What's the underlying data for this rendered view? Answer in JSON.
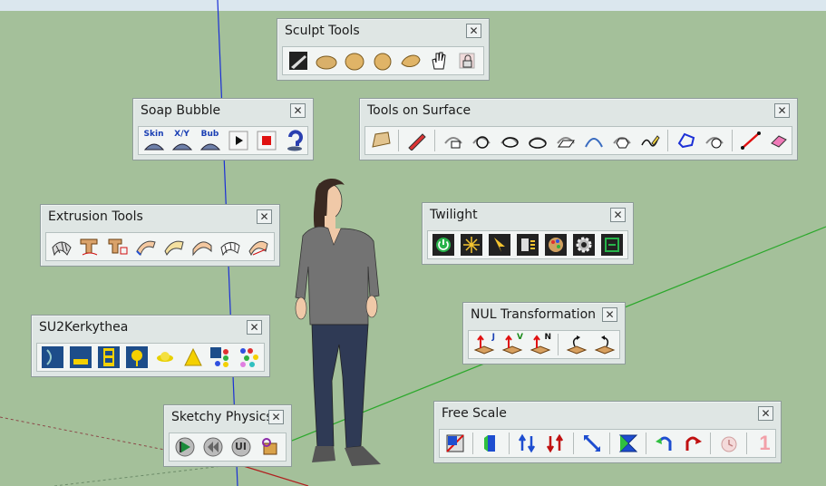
{
  "toolbars": {
    "sculpt_tools": {
      "title": "Sculpt Tools",
      "close": "✕"
    },
    "soap_bubble": {
      "title": "Soap Bubble",
      "close": "✕",
      "btn_skin": "Skin",
      "btn_xy": "X/Y",
      "btn_bub": "Bub"
    },
    "tools_on_surface": {
      "title": "Tools on Surface",
      "close": "✕"
    },
    "extrusion_tools": {
      "title": "Extrusion Tools",
      "close": "✕"
    },
    "twilight": {
      "title": "Twilight",
      "close": "✕"
    },
    "su2kerkythea": {
      "title": "SU2Kerkythea",
      "close": "✕"
    },
    "nul_transformation": {
      "title": "NUL Transformation",
      "close": "✕",
      "btn_j": "J",
      "btn_v": "V",
      "btn_n": "N"
    },
    "sketchy_physics": {
      "title": "Sketchy Physics",
      "close": "✕",
      "btn_ui": "UI"
    },
    "free_scale": {
      "title": "Free Scale",
      "close": "✕",
      "btn_one": "1"
    }
  },
  "colors": {
    "background": "#a4c09a",
    "sky": "#dbe7ee",
    "panel": "#dfe6e4",
    "blue_axis": "#1b2fd6",
    "green_axis": "#2ca82c",
    "red_axis": "#b02020"
  },
  "icons": {
    "sculpt_tools": [
      "sculpt-brush-icon",
      "inflate-icon",
      "smooth-icon",
      "sphere-icon",
      "pinch-icon",
      "hand-icon",
      "lock-icon"
    ],
    "soap_bubble": [
      "skin-icon",
      "xy-icon",
      "bub-icon",
      "play-icon",
      "stop-icon",
      "help-icon"
    ],
    "tools_on_surface": [
      "surface-icon",
      "pencil-icon",
      "rect-on-surface-icon",
      "circle-on-surface-icon",
      "ellipse-on-surface-icon",
      "ellipse2-on-surface-icon",
      "parallelogram-icon",
      "arc-icon",
      "polygon-icon",
      "freehand-icon",
      "offset-icon",
      "edge-icon",
      "line-icon",
      "eraser-icon"
    ],
    "extrusion_tools": [
      "extrude-grid-icon",
      "t-extrude-icon",
      "t-extrude2-icon",
      "extrude-edges-icon",
      "skin-surface-icon",
      "lofting-icon",
      "grid-loft-icon",
      "follow-surface-icon"
    ],
    "twilight": [
      "power-icon",
      "light-icon",
      "sun-icon",
      "material-icon",
      "palette-icon",
      "gear-icon",
      "render-icon"
    ],
    "su2kerkythea": [
      "export-icon",
      "model-icon",
      "film-icon",
      "tree-icon",
      "sun-object-icon",
      "cone-icon",
      "layers-icon",
      "dots-icon"
    ],
    "sketchy_physics": [
      "play-icon",
      "rewind-icon",
      "ui-icon",
      "joint-icon"
    ],
    "free_scale": [
      "scale-box-icon",
      "scale-bar-icon",
      "stretch-up-icon",
      "stretch-down-icon",
      "diag-scale-icon",
      "taper-icon",
      "rotate-cw-icon",
      "rotate-ccw-icon",
      "clock-icon",
      "one-icon"
    ]
  }
}
